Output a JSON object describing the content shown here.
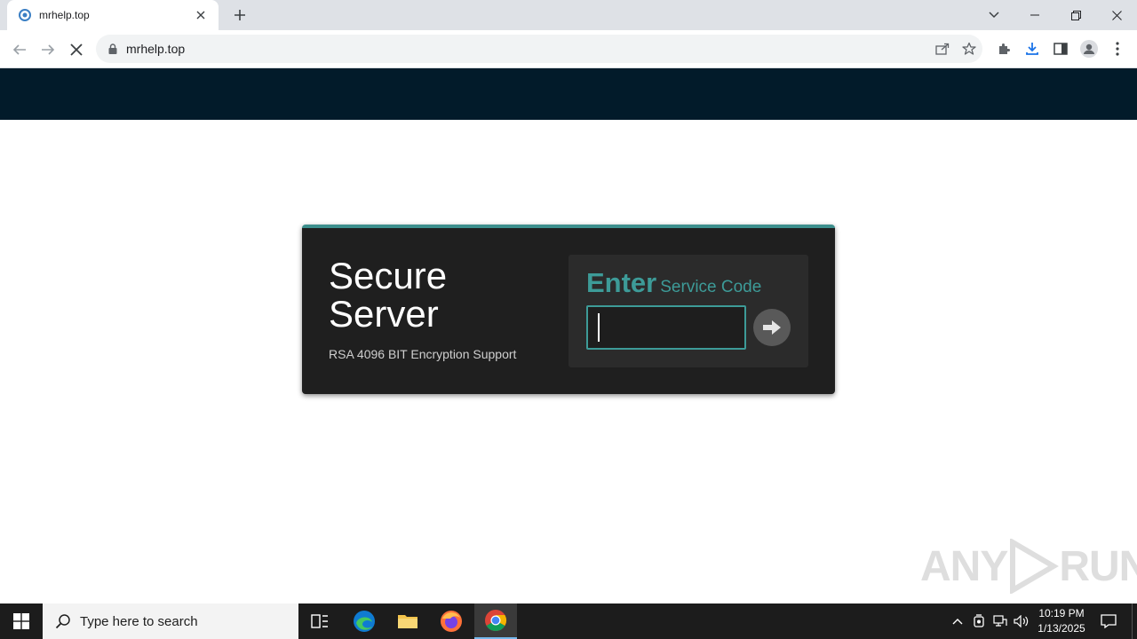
{
  "browser": {
    "tab": {
      "title": "mrhelp.top"
    },
    "address_bar": {
      "url": "mrhelp.top"
    }
  },
  "page": {
    "card": {
      "title": "Secure Server",
      "subtitle": "RSA 4096 BIT Encryption Support",
      "code_heading_bold": "Enter",
      "code_heading_rest": "Service Code",
      "code_value": ""
    },
    "watermark": {
      "left": "ANY",
      "right": "RUN"
    }
  },
  "taskbar": {
    "search_placeholder": "Type here to search",
    "time": "10:19 PM",
    "date": "1/13/2025",
    "pinned": [
      "task-view-icon",
      "edge-icon",
      "file-explorer-icon",
      "firefox-icon",
      "chrome-icon"
    ]
  },
  "colors": {
    "header_band": "#021b2a",
    "card_bg": "#1f1f1f",
    "accent_teal": "#3d9b98",
    "taskbar": "#1c1c1c"
  }
}
